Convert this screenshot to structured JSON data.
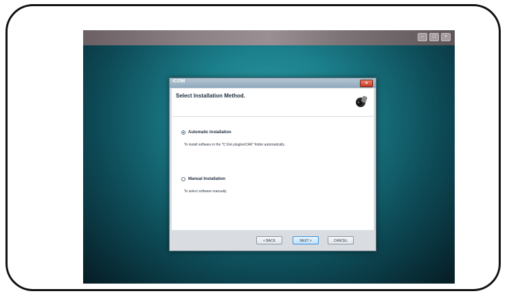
{
  "taskbar": {
    "min_glyph": "–",
    "max_glyph": "□",
    "close_glyph": "×"
  },
  "dialog": {
    "title": "iCOM",
    "close_glyph": "×",
    "header_title": "Select Installation Method.",
    "icon": "camera-icon",
    "options": [
      {
        "label": "Automatic Installation",
        "description": "To install software in the \"C:\\Gin plugins\\CAK\" folder automatically.",
        "selected": true
      },
      {
        "label": "Manual Installation",
        "description": "To select software manually.",
        "selected": false
      }
    ],
    "buttons": {
      "back": "< BACK",
      "next": "NEXT >",
      "cancel": "CANCEL"
    }
  },
  "colors": {
    "accent": "#3a8fd8",
    "close": "#c93a22",
    "desktop": "#1c7f8c"
  }
}
